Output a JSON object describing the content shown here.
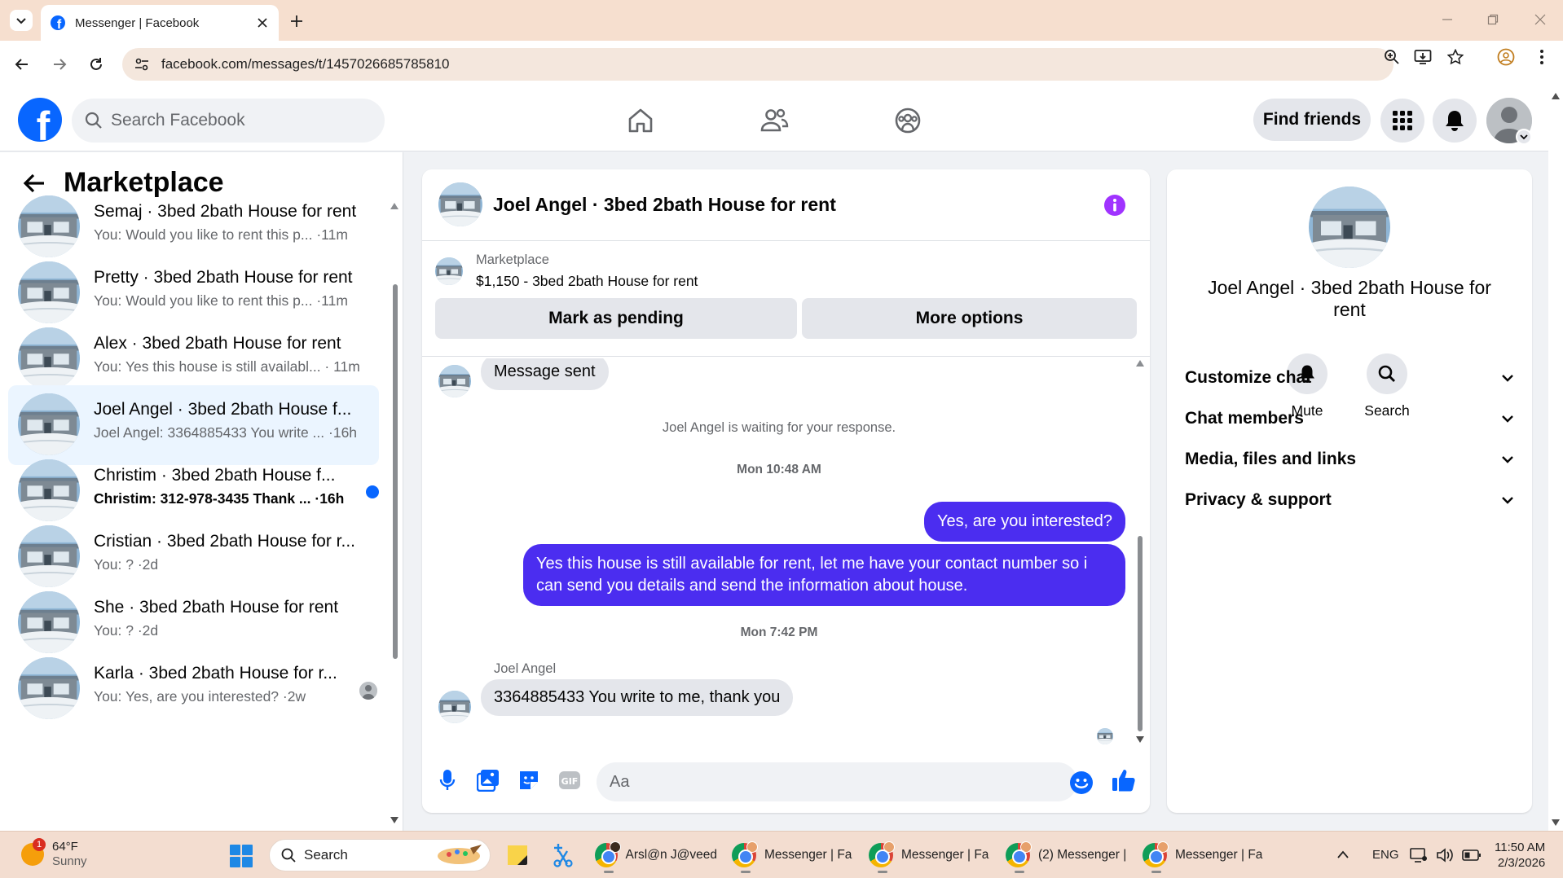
{
  "browser": {
    "tab_title": "Messenger | Facebook",
    "url": "facebook.com/messages/t/1457026685785810"
  },
  "fb": {
    "search_placeholder": "Search Facebook",
    "find_friends": "Find friends"
  },
  "sidebar": {
    "title": "Marketplace",
    "chats": [
      {
        "name": "Semaj · 3bed 2bath House for rent",
        "preview": "You: Would you like to rent this p... ·11m",
        "state": "read"
      },
      {
        "name": "Pretty · 3bed 2bath House for rent",
        "preview": "You: Would you like to rent this p... ·11m",
        "state": "read"
      },
      {
        "name": "Alex · 3bed 2bath House for rent",
        "preview": "You: Yes this house is still availabl... · 11m",
        "state": "read"
      },
      {
        "name": "Joel Angel · 3bed 2bath House f...",
        "preview": "Joel Angel: 3364885433 You write ... ·16h",
        "state": "selected"
      },
      {
        "name": "Christim · 3bed 2bath House f...",
        "preview": "Christim: 312-978-3435 Thank ... ·16h",
        "state": "unread"
      },
      {
        "name": "Cristian · 3bed 2bath House for r...",
        "preview": "You: ? ·2d",
        "state": "read"
      },
      {
        "name": "She · 3bed 2bath House for rent",
        "preview": "You: ? ·2d",
        "state": "read"
      },
      {
        "name": "Karla · 3bed 2bath House for r...",
        "preview": "You: Yes, are you interested? ·2w",
        "state": "seen"
      }
    ]
  },
  "conversation": {
    "title": "Joel Angel · 3bed 2bath House for rent",
    "marketplace_label": "Marketplace",
    "listing": "$1,150 - 3bed 2bath House for rent",
    "mark_pending": "Mark as pending",
    "more_options": "More options",
    "msg_sent": "Message sent",
    "waiting": "Joel Angel is waiting for your response.",
    "time1": "Mon 10:48 AM",
    "out1": "Yes, are you interested?",
    "out2": "Yes this house is still available for rent, let me have your contact number so i can send you details and send the information about house.",
    "time2": "Mon 7:42 PM",
    "sender": "Joel Angel",
    "in2": "3364885433 You write to me, thank you",
    "composer_placeholder": "Aa"
  },
  "info_panel": {
    "name": "Joel Angel · 3bed 2bath House for rent",
    "mute": "Mute",
    "search": "Search",
    "sections": [
      "Customize chat",
      "Chat members",
      "Media, files and links",
      "Privacy & support"
    ]
  },
  "taskbar": {
    "weather_temp": "64°F",
    "weather_cond": "Sunny",
    "weather_badge": "1",
    "search": "Search",
    "apps": [
      "Arsl@n J@veed",
      "Messenger | Fa",
      "Messenger | Fa",
      "(2) Messenger |",
      "Messenger | Fa"
    ],
    "lang": "ENG",
    "time": "11:50 AM",
    "date": "2/3/2026"
  },
  "colors": {
    "fb_blue": "#0866ff",
    "bubble_out": "#4b2df0",
    "info_purple": "#a033ff"
  }
}
